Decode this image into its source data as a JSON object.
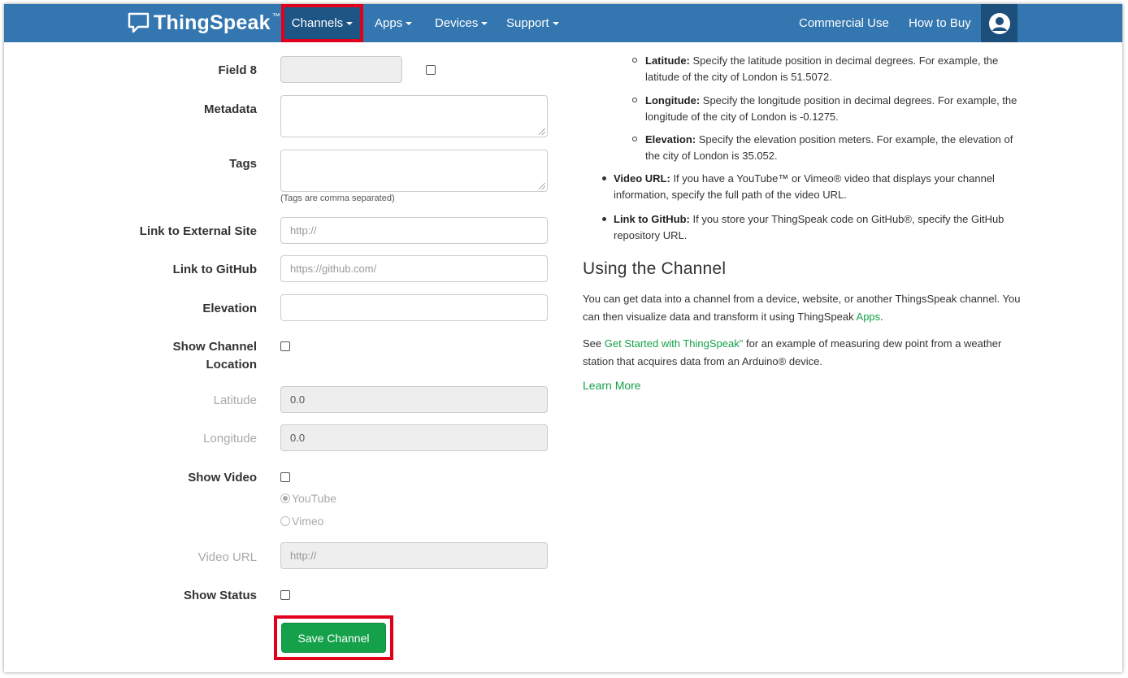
{
  "navbar": {
    "brand": "ThingSpeak",
    "brand_tm": "™",
    "items": {
      "channels": "Channels",
      "apps": "Apps",
      "devices": "Devices",
      "support": "Support",
      "commercial": "Commercial Use",
      "howtobuy": "How to Buy"
    },
    "colors": {
      "bar": "#3376b0",
      "active": "#1d5585",
      "highlight": "#e0001b"
    }
  },
  "form": {
    "field8_label": "Field 8",
    "metadata_label": "Metadata",
    "tags_label": "Tags",
    "tags_help": "(Tags are comma separated)",
    "external_label": "Link to External Site",
    "external_placeholder": "http://",
    "github_label": "Link to GitHub",
    "github_placeholder": "https://github.com/",
    "elevation_label": "Elevation",
    "show_location_label_1": "Show Channel",
    "show_location_label_2": "Location",
    "latitude_label": "Latitude",
    "latitude_value": "0.0",
    "longitude_label": "Longitude",
    "longitude_value": "0.0",
    "show_video_label": "Show Video",
    "youtube_label": "YouTube",
    "vimeo_label": "Vimeo",
    "video_url_label": "Video URL",
    "video_url_placeholder": "http://",
    "show_status_label": "Show Status",
    "save_label": "Save Channel",
    "save_color": "#14a14a"
  },
  "help": {
    "latitude_title": "Latitude:",
    "latitude_text_1": " Specify the latitude position in decimal degrees. For example, the",
    "latitude_text_2": "latitude of the city of London is 51.5072.",
    "longitude_title": "Longitude:",
    "longitude_text_1": " Specify the longitude position in decimal degrees. For example, the",
    "longitude_text_2": "longitude of the city of London is -0.1275.",
    "elevation_title": "Elevation:",
    "elevation_text_1": " Specify the elevation position meters. For example, the elevation of",
    "elevation_text_2": "the city of London is 35.052.",
    "video_title": "Video URL:",
    "video_text_1": " If you have a YouTube™ or Vimeo® video that displays your channel",
    "video_text_2": "information, specify the full path of the video URL.",
    "github_title": "Link to GitHub:",
    "github_text_1": " If you store your ThingSpeak code on GitHub®, specify the GitHub",
    "github_text_2": "repository URL.",
    "using_title": "Using the Channel",
    "using_p1_line1": "You can get data into a channel from a device, website, or another ThingsSpeak channel. You",
    "using_p1_line2a": "can then visualize data and transform it using ThingSpeak ",
    "using_p1_apps": "Apps",
    "using_p1_line2b": ".",
    "using_p2_a": "See ",
    "using_p2_link": "Get Started with ThingSpeak\"",
    "using_p2_b": " for an example of measuring dew point from a weather",
    "using_p2_line2": "station that acquires data from an Arduino® device.",
    "learn_more": "Learn More"
  }
}
